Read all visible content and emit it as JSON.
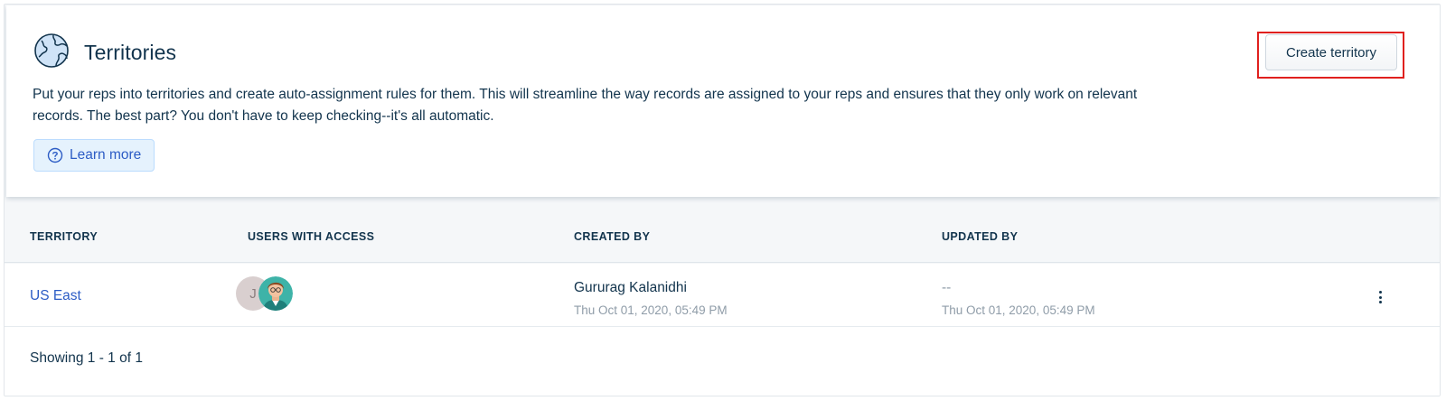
{
  "header": {
    "icon": "globe-icon",
    "title": "Territories",
    "description": "Put your reps into territories and create auto-assignment rules for them. This will streamline the way records are assigned to your reps and ensures that they only work on relevant records. The best part? You don't have to keep checking--it's all automatic.",
    "learn_more_label": "Learn more",
    "create_button_label": "Create territory"
  },
  "colors": {
    "link": "#2c5cc5",
    "text": "#12344d",
    "highlight_box": "#e0201e",
    "learn_more_bg": "#e5f2fd"
  },
  "table": {
    "columns": [
      "TERRITORY",
      "USERS WITH ACCESS",
      "CREATED BY",
      "UPDATED BY"
    ],
    "rows": [
      {
        "territory": "US East",
        "users": [
          {
            "initial": "J",
            "type": "initial-avatar"
          },
          {
            "type": "photo-avatar"
          }
        ],
        "created_by": "Gururag Kalanidhi",
        "created_at": "Thu Oct 01, 2020, 05:49 PM",
        "updated_by": "--",
        "updated_at": "Thu Oct 01, 2020, 05:49 PM"
      }
    ],
    "footer": "Showing 1 - 1 of 1"
  }
}
